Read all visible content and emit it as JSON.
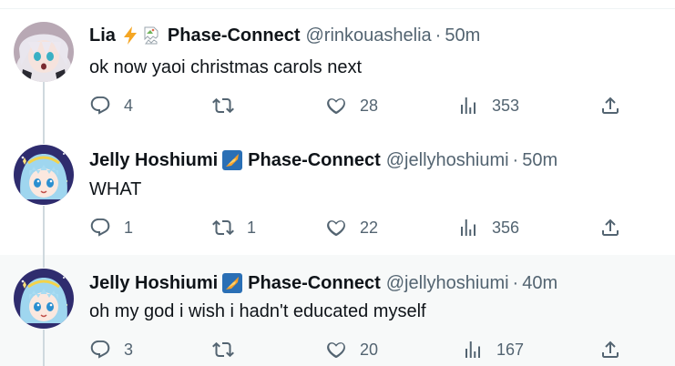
{
  "tweets": [
    {
      "name": "Lia",
      "badge_icons": [
        "lightning-icon",
        "broken-image-icon"
      ],
      "affiliation": "Phase-Connect",
      "handle": "@rinkouashelia",
      "separator": "·",
      "time": "50m",
      "text": "ok now yaoi christmas carols next",
      "replies": "4",
      "retweets": "",
      "likes": "28",
      "views": "353"
    },
    {
      "name": "Jelly Hoshiumi",
      "badge_icons": [
        "phase-connect-logo-icon"
      ],
      "affiliation": "Phase-Connect",
      "handle": "@jellyhoshiumi",
      "separator": "·",
      "time": "50m",
      "text": "WHAT",
      "replies": "1",
      "retweets": "1",
      "likes": "22",
      "views": "356"
    },
    {
      "name": "Jelly Hoshiumi",
      "badge_icons": [
        "phase-connect-logo-icon"
      ],
      "affiliation": "Phase-Connect",
      "handle": "@jellyhoshiumi",
      "separator": "·",
      "time": "40m",
      "text": "oh my god i wish i hadn't educated myself",
      "replies": "3",
      "retweets": "",
      "likes": "20",
      "views": "167"
    }
  ],
  "colors": {
    "text": "#0f1419",
    "secondary": "#536471",
    "thread_line": "#cfd9de",
    "highlight_bg": "#f7f9f9",
    "lightning": "#f5a623"
  }
}
